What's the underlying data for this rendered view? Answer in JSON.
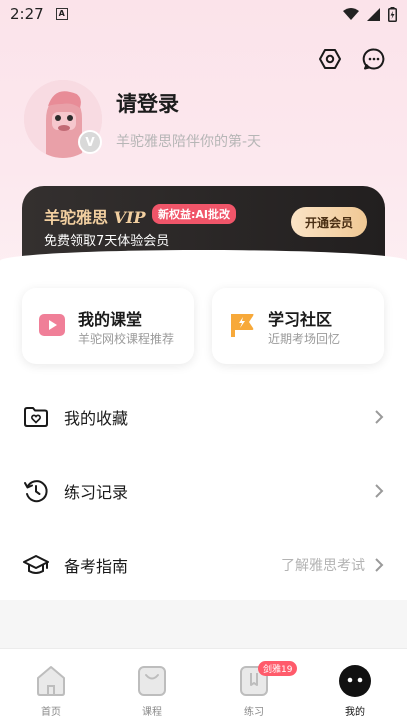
{
  "status_bar": {
    "time": "2:27",
    "notification_glyph": "A"
  },
  "profile": {
    "title": "请登录",
    "subtitle": "羊驼雅思陪伴你的第-天",
    "badge": "V"
  },
  "vip": {
    "brand": "羊驼雅思",
    "brand_suffix": "VIP",
    "pill": "新权益:AI批改",
    "subtitle": "免费领取7天体验会员",
    "button": "开通会员"
  },
  "cards": [
    {
      "title": "我的课堂",
      "subtitle": "羊驼网校课程推荐"
    },
    {
      "title": "学习社区",
      "subtitle": "近期考场回忆"
    }
  ],
  "menu": [
    {
      "label": "我的收藏",
      "hint": ""
    },
    {
      "label": "练习记录",
      "hint": ""
    },
    {
      "label": "备考指南",
      "hint": "了解雅思考试"
    }
  ],
  "tabs": [
    {
      "label": "首页",
      "badge": ""
    },
    {
      "label": "课程",
      "badge": ""
    },
    {
      "label": "练习",
      "badge": "剑雅19"
    },
    {
      "label": "我的",
      "badge": ""
    }
  ],
  "colors": {
    "accent_pink": "#ff5b6b",
    "vip_gold": "#f2cfa0",
    "vip_dark": "#2b2726",
    "icon_pink": "#f07f98",
    "icon_orange": "#f7a93a"
  }
}
